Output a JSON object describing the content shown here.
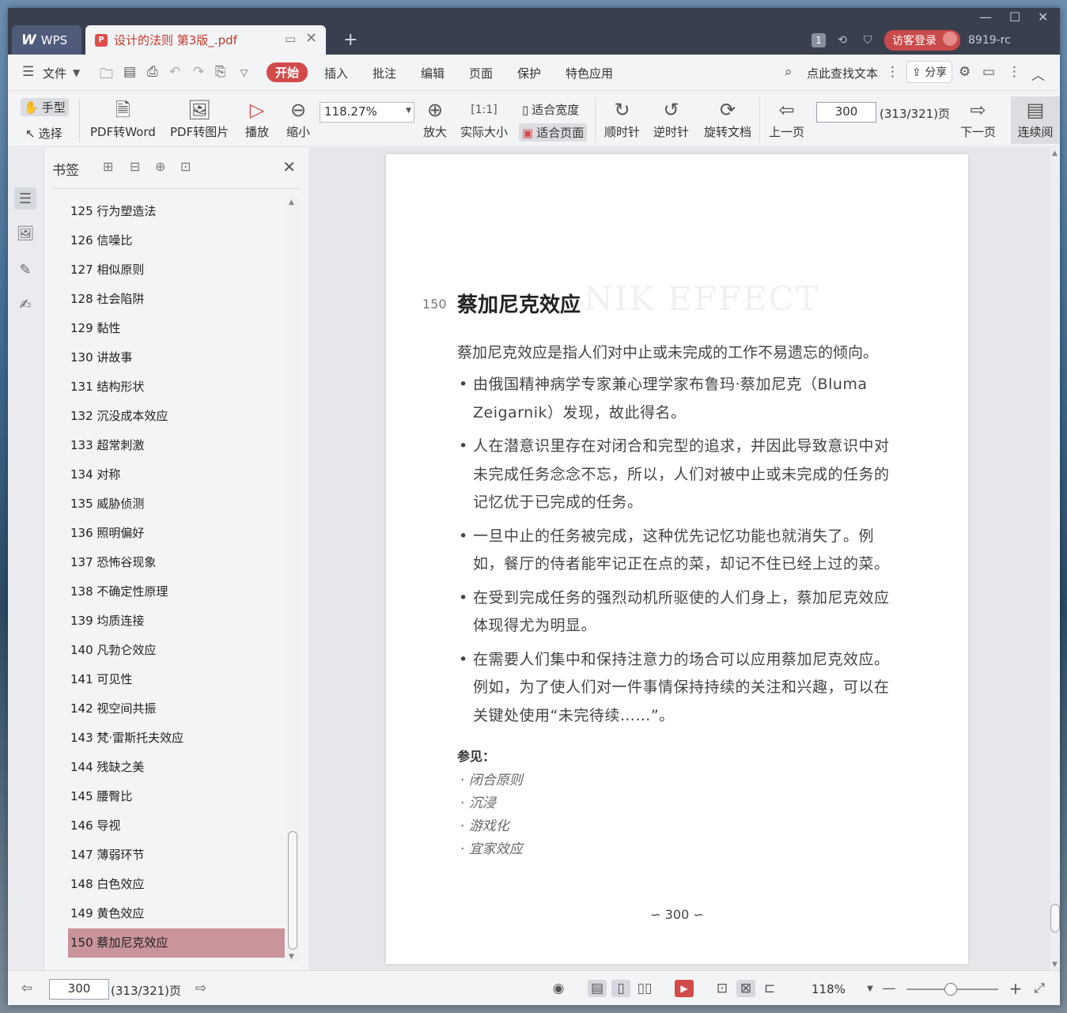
{
  "titlebar": {
    "app_tab": "WPS",
    "doc_tab": "设计的法则 第3版_.pdf",
    "page_badge": "1",
    "login_label": "访客登录",
    "user_id": "8919-rc"
  },
  "menubar": {
    "file": "文件",
    "tabs": [
      "开始",
      "插入",
      "批注",
      "编辑",
      "页面",
      "保护",
      "特色应用"
    ],
    "search": "点此查找文本",
    "share": "分享"
  },
  "ribbon": {
    "hand": "手型",
    "select": "选择",
    "pdf_word": "PDF转Word",
    "pdf_image": "PDF转图片",
    "play": "播放",
    "zoom_out": "缩小",
    "zoom_value": "118.27%",
    "zoom_in": "放大",
    "actual_size": "实际大小",
    "fit_width": "适合宽度",
    "fit_page": "适合页面",
    "clockwise": "顺时针",
    "counter_clockwise": "逆时针",
    "rotate_doc": "旋转文档",
    "prev_page": "上一页",
    "page_value": "300",
    "page_total": "(313/321)页",
    "next_page": "下一页",
    "continuous": "连续阅"
  },
  "bookmarks": {
    "title": "书签",
    "items": [
      "125 行为塑造法",
      "126 信噪比",
      "127 相似原则",
      "128 社会陷阱",
      "129 黏性",
      "130 讲故事",
      "131 结构形状",
      "132 沉没成本效应",
      "133 超常刺激",
      "134 对称",
      "135 威胁侦测",
      "136 照明偏好",
      "137 恐怖谷现象",
      "138 不确定性原理",
      "139 均质连接",
      "140 凡勃仑效应",
      "141 可见性",
      "142 视空间共振",
      "143 梵·雷斯托夫效应",
      "144 残缺之美",
      "145 腰臀比",
      "146 导视",
      "147 薄弱环节",
      "148 白色效应",
      "149 黄色效应",
      "150 蔡加尼克效应"
    ]
  },
  "page": {
    "chapter_number": "150",
    "chapter_title": "蔡加尼克效应",
    "ghost_title": "NIK EFFECT",
    "intro": "蔡加尼克效应是指人们对中止或未完成的工作不易遗忘的倾向。",
    "bullets": [
      "由俄国精神病学专家兼心理学家布鲁玛·蔡加尼克（Bluma Zeigarnik）发现，故此得名。",
      "人在潜意识里存在对闭合和完型的追求，并因此导致意识中对未完成任务念念不忘，所以，人们对被中止或未完成的任务的记忆优于已完成的任务。",
      "一旦中止的任务被完成，这种优先记忆功能也就消失了。例如，餐厅的侍者能牢记正在点的菜，却记不住已经上过的菜。",
      "在受到完成任务的强烈动机所驱使的人们身上，蔡加尼克效应体现得尤为明显。",
      "在需要人们集中和保持注意力的场合可以应用蔡加尼克效应。例如，为了使人们对一件事情保持持续的关注和兴趣，可以在关键处使用“未完待续……”。"
    ],
    "see_also_label": "参见：",
    "see_also": [
      "闭合原则",
      "沉浸",
      "游戏化",
      "宜家效应"
    ],
    "footer": "∽ 300 ∽"
  },
  "statusbar": {
    "page_value": "300",
    "page_total": "(313/321)页",
    "zoom": "118%"
  },
  "colors": {
    "accent": "#d24b4b",
    "titlebar": "#3a3f4e",
    "selected_bookmark": "#c9949a"
  }
}
